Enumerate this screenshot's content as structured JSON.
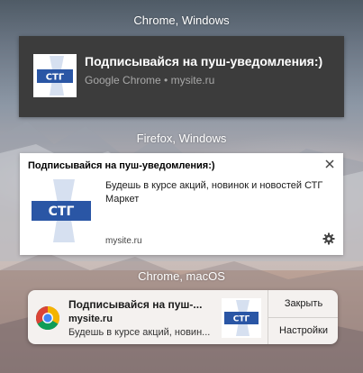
{
  "captions": {
    "chrome_windows": "Chrome, Windows",
    "firefox_windows": "Firefox, Windows",
    "chrome_macos": "Chrome, macOS"
  },
  "brand": {
    "logo_text": "СТГ",
    "logo_color": "#2a56a5",
    "logo_light": "#d6e0f0"
  },
  "chrome_windows": {
    "title": "Подписывайся на пуш-уведомления:)",
    "subtitle": "Google Chrome • mysite.ru",
    "background": "#3c3c3c"
  },
  "firefox_windows": {
    "title": "Подписывайся на пуш-уведомления:)",
    "body": "Будешь в курсе акций, новинок и новостей СТГ Маркет",
    "site": "mysite.ru",
    "close_icon": "close-icon",
    "settings_icon": "gear-icon"
  },
  "chrome_macos": {
    "title": "Подписывайся на пуш-...",
    "site": "mysite.ru",
    "body": "Будешь в курсе акций, новин...",
    "close_label": "Закрыть",
    "settings_label": "Настройки",
    "app_icon": "chrome-icon"
  }
}
